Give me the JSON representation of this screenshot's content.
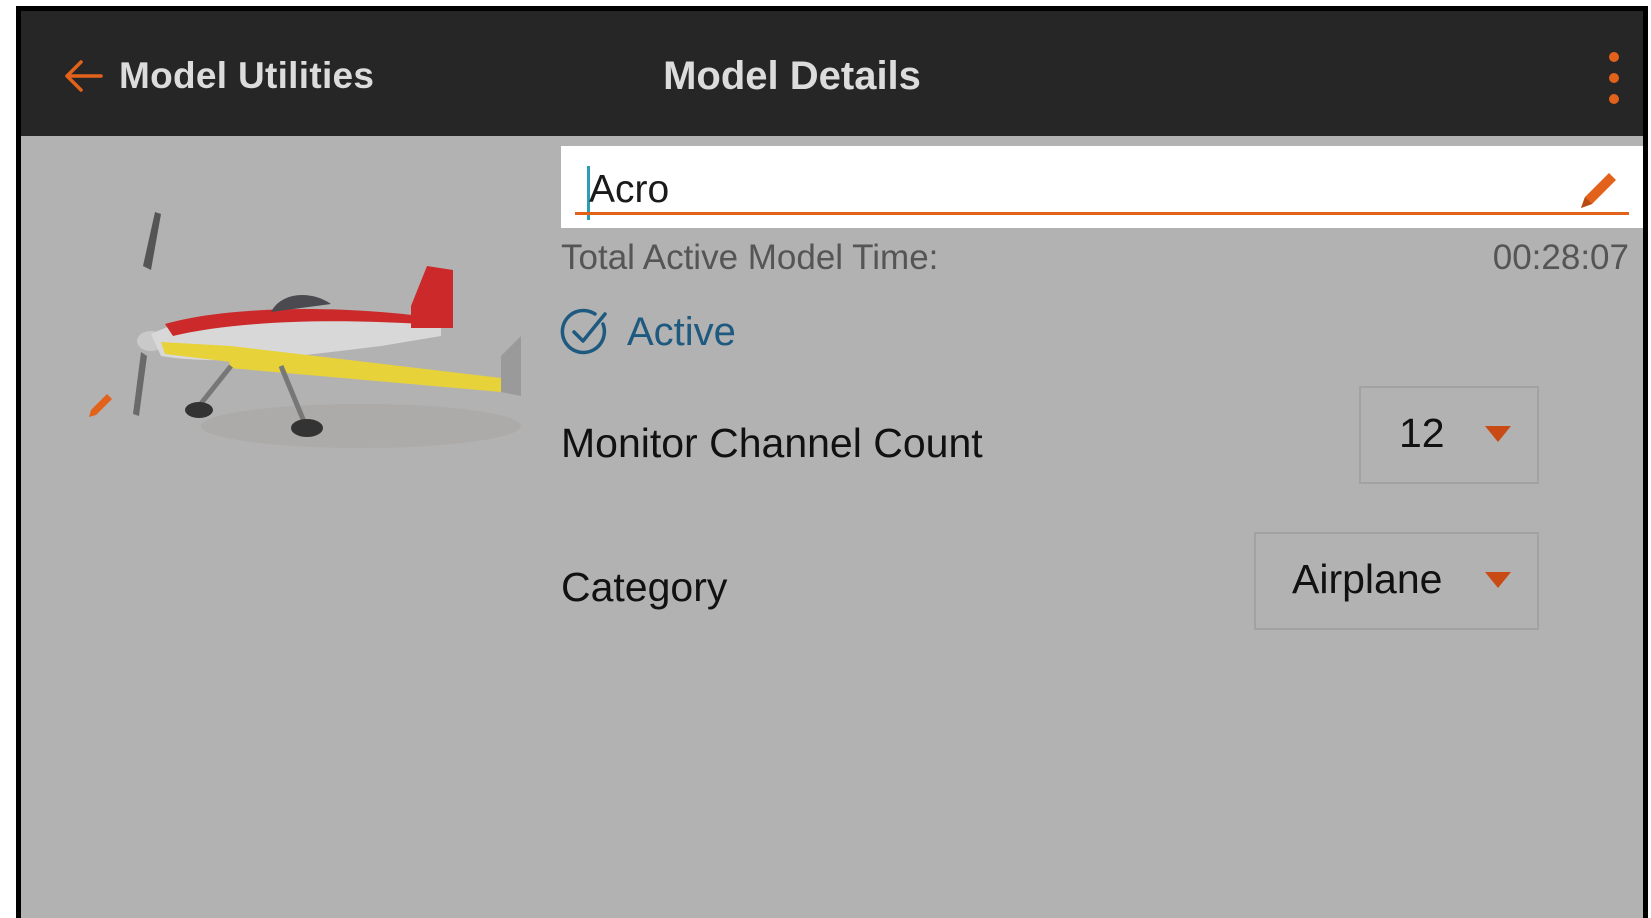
{
  "header": {
    "back_label": "Model Utilities",
    "title": "Model Details",
    "back_icon": "arrow-left-icon",
    "menu_icon": "more-vertical-icon"
  },
  "model": {
    "name_value": "Acro",
    "total_time_label": "Total Active Model Time:",
    "total_time_value": "00:28:07",
    "active_label": "Active"
  },
  "fields": {
    "monitor_channel_count": {
      "label": "Monitor Channel Count",
      "value": "12"
    },
    "category": {
      "label": "Category",
      "value": "Airplane"
    }
  },
  "colors": {
    "accent": "#e2621b",
    "active": "#1e5a80",
    "header_bg": "#262626",
    "content_bg": "#b2b2b2"
  }
}
